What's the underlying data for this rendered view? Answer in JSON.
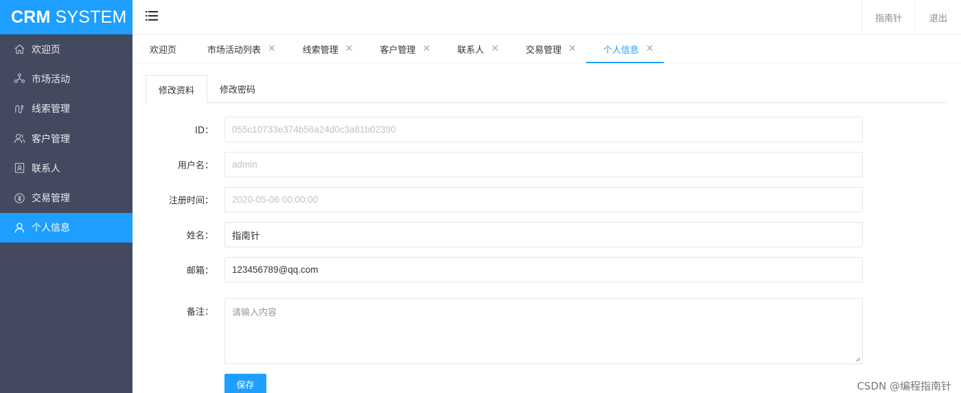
{
  "app": {
    "logo_bold": "CRM",
    "logo_light": "SYSTEM"
  },
  "sidebar": {
    "items": [
      {
        "label": "欢迎页",
        "icon": "home-icon",
        "active": false
      },
      {
        "label": "市场活动",
        "icon": "network-icon",
        "active": false
      },
      {
        "label": "线索管理",
        "icon": "clue-icon",
        "active": false
      },
      {
        "label": "客户管理",
        "icon": "users-icon",
        "active": false
      },
      {
        "label": "联系人",
        "icon": "contact-card-icon",
        "active": false
      },
      {
        "label": "交易管理",
        "icon": "yen-coin-icon",
        "active": false
      },
      {
        "label": "个人信息",
        "icon": "user-icon",
        "active": true
      }
    ]
  },
  "header": {
    "user_name": "指南针",
    "logout_label": "退出"
  },
  "tabs": [
    {
      "label": "欢迎页",
      "closable": false,
      "active": false
    },
    {
      "label": "市场活动列表",
      "closable": true,
      "active": false
    },
    {
      "label": "线索管理",
      "closable": true,
      "active": false
    },
    {
      "label": "客户管理",
      "closable": true,
      "active": false
    },
    {
      "label": "联系人",
      "closable": true,
      "active": false
    },
    {
      "label": "交易管理",
      "closable": true,
      "active": false
    },
    {
      "label": "个人信息",
      "closable": true,
      "active": true
    }
  ],
  "tab_close_glyph": "✕",
  "subtabs": {
    "profile": "修改资料",
    "password": "修改密码"
  },
  "form": {
    "id": {
      "label": "ID：",
      "value": "055c10733e374b56a24d0c3a81b02390"
    },
    "username": {
      "label": "用户名：",
      "value": "admin"
    },
    "register_time": {
      "label": "注册时间：",
      "value": "2020-05-06 00:00:00"
    },
    "name": {
      "label": "姓名：",
      "value": "指南针"
    },
    "email": {
      "label": "邮箱：",
      "value": "123456789@qq.com"
    },
    "remark": {
      "label": "备注：",
      "placeholder": "请输入内容"
    },
    "save_label": "保存"
  },
  "watermark": "CSDN @编程指南针",
  "colors": {
    "accent": "#1e9fff",
    "sidebar_bg": "#434a60"
  }
}
